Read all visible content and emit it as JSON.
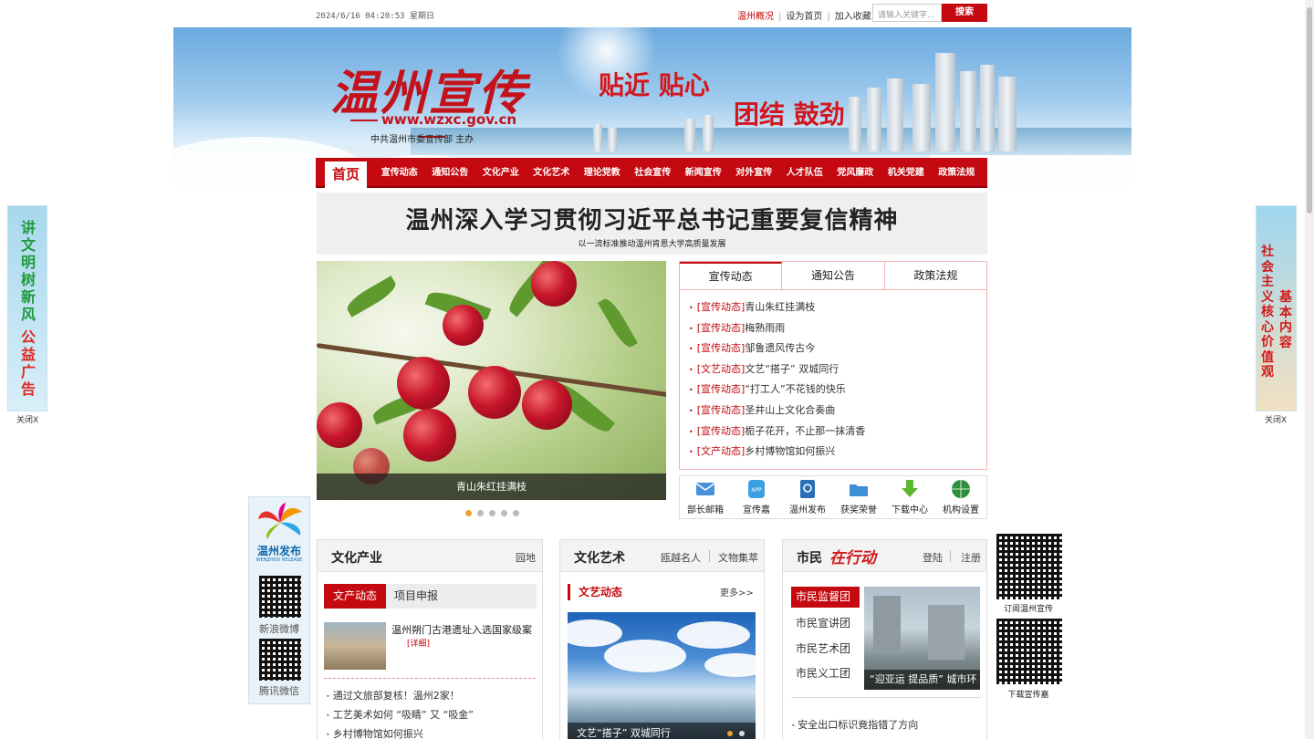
{
  "topbar": {
    "datetime": "2024/6/16 04:20:53 星期日",
    "link_overview": "温州概况",
    "link_homepage": "设为首页",
    "link_favorite": "加入收藏",
    "search_placeholder": "请输入关键字...",
    "search_button": "搜索"
  },
  "banner": {
    "logo_text": "温州宣传",
    "url": "www.wzxc.gov.cn",
    "sponsor": "中共温州市委宣传部  主办",
    "slogan_1": "贴近  贴心",
    "slogan_2": "团结  鼓劲"
  },
  "nav": {
    "home": "首页",
    "items": [
      "宣传动态",
      "通知公告",
      "文化产业",
      "文化艺术",
      "理论党教",
      "社会宣传",
      "新闻宣传",
      "对外宣传",
      "人才队伍",
      "党风廉政",
      "机关党建",
      "政策法规"
    ]
  },
  "headline": {
    "title": "温州深入学习贯彻习近平总书记重要复信精神",
    "subtitle": "以一流标准推动温州肯恩大学高质量发展"
  },
  "slideshow": {
    "caption": "青山朱红挂满枝",
    "dots": 5,
    "active_dot": 1
  },
  "news_tabs": {
    "tabs": [
      "宣传动态",
      "通知公告",
      "政策法规"
    ],
    "active": 0,
    "items": [
      {
        "tag": "[宣传动态]",
        "title": "青山朱红挂满枝"
      },
      {
        "tag": "[宣传动态]",
        "title": "梅熟雨雨"
      },
      {
        "tag": "[宣传动态]",
        "title": "邹鲁遗风传古今"
      },
      {
        "tag": "[文艺动态]",
        "title": "文艺“搭子” 双城同行"
      },
      {
        "tag": "[宣传动态]",
        "title": "“打工人”不花钱的快乐"
      },
      {
        "tag": "[宣传动态]",
        "title": "圣井山上文化合奏曲"
      },
      {
        "tag": "[宣传动态]",
        "title": "栀子花开，不止那一抹清香"
      },
      {
        "tag": "[文产动态]",
        "title": "乡村博物馆如何振兴"
      }
    ]
  },
  "quick_links": [
    {
      "label": "部长邮箱",
      "icon": "mail-icon",
      "color": "#4a90d9"
    },
    {
      "label": "宣传嘉",
      "icon": "app-icon",
      "color": "#3aa0e0"
    },
    {
      "label": "温州发布",
      "icon": "book-icon",
      "color": "#2a6fb8"
    },
    {
      "label": "获奖荣誉",
      "icon": "folder-icon",
      "color": "#3d8fd6"
    },
    {
      "label": "下载中心",
      "icon": "download-icon",
      "color": "#5db82e"
    },
    {
      "label": "机构设置",
      "icon": "globe-icon",
      "color": "#2f8f3f"
    }
  ],
  "ad_left": {
    "line_1": "讲文明树新风",
    "line_2": "公益广告",
    "close": "关闭X"
  },
  "ad_right": {
    "col_1": "社会主义核心价值观",
    "col_2": "基本内容",
    "close": "关闭X"
  },
  "weibo_sidebar": {
    "title": "温州发布",
    "subtitle": "WENZHOU RELEASE",
    "sina_label": "新浪微博",
    "tencent_label": "腾讯微信"
  },
  "right_qr": {
    "label_1": "订阅温州宣传",
    "label_2": "下载宣传嘉"
  },
  "panel_culture_industry": {
    "title": "文化产业",
    "link": "园地",
    "tab_active": "文产动态",
    "tab_other": "项目申报",
    "feature_title": "温州朔门古港遗址入选国家级案",
    "feature_detail": "[详细]",
    "items": [
      "通过文旅部复核！温州2家！",
      "工艺美术如何 “吸睛” 又 “吸金”",
      "乡村博物馆如何振兴"
    ]
  },
  "panel_culture_art": {
    "title": "文化艺术",
    "link_1": "瓯越名人",
    "link_2": "文物集萃",
    "sub_title": "文艺动态",
    "more": "更多>>",
    "photo_caption": "文艺“搭子” 双城同行"
  },
  "panel_citizen": {
    "title": "市民",
    "brand": "在行动",
    "link_login": "登陆",
    "link_register": "注册",
    "groups": [
      "市民监督团",
      "市民宣讲团",
      "市民艺术团",
      "市民义工团"
    ],
    "photo_caption": "“迎亚运 提品质” 城市环",
    "item": "安全出口标识竟指错了方向"
  }
}
